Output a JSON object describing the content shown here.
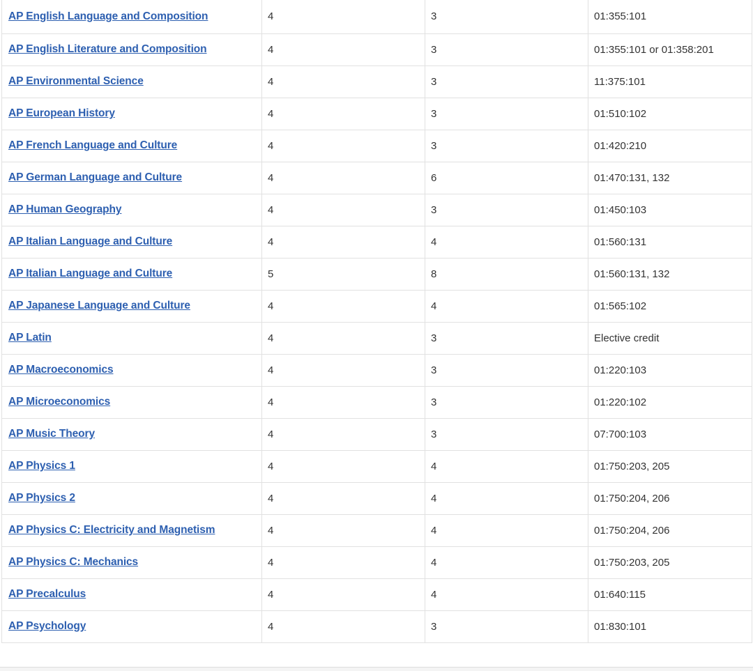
{
  "table": {
    "rows": [
      {
        "exam": "AP English Language and Composition",
        "score": "4",
        "credits": "3",
        "equivalent": "01:355:101"
      },
      {
        "exam": "AP English Literature and Composition",
        "score": "4",
        "credits": "3",
        "equivalent": "01:355:101 or 01:358:201"
      },
      {
        "exam": "AP Environmental Science",
        "score": "4",
        "credits": "3",
        "equivalent": "11:375:101"
      },
      {
        "exam": "AP European History",
        "score": "4",
        "credits": "3",
        "equivalent": "01:510:102"
      },
      {
        "exam": "AP French Language and Culture",
        "score": "4",
        "credits": "3",
        "equivalent": "01:420:210"
      },
      {
        "exam": "AP German Language and Culture",
        "score": "4",
        "credits": "6",
        "equivalent": "01:470:131, 132"
      },
      {
        "exam": "AP Human Geography",
        "score": "4",
        "credits": "3",
        "equivalent": "01:450:103"
      },
      {
        "exam": "AP Italian Language and Culture",
        "score": "4",
        "credits": "4",
        "equivalent": "01:560:131"
      },
      {
        "exam": "AP Italian Language and Culture",
        "score": "5",
        "credits": "8",
        "equivalent": "01:560:131, 132"
      },
      {
        "exam": "AP Japanese Language and Culture",
        "score": "4",
        "credits": "4",
        "equivalent": "01:565:102"
      },
      {
        "exam": "AP Latin",
        "score": "4",
        "credits": "3",
        "equivalent": "Elective credit"
      },
      {
        "exam": "AP Macroeconomics",
        "score": "4",
        "credits": "3",
        "equivalent": "01:220:103"
      },
      {
        "exam": "AP Microeconomics",
        "score": "4",
        "credits": "3",
        "equivalent": "01:220:102"
      },
      {
        "exam": "AP Music Theory",
        "score": "4",
        "credits": "3",
        "equivalent": "07:700:103"
      },
      {
        "exam": "AP Physics 1",
        "score": "4",
        "credits": "4",
        "equivalent": "01:750:203, 205"
      },
      {
        "exam": "AP Physics 2",
        "score": "4",
        "credits": "4",
        "equivalent": "01:750:204, 206"
      },
      {
        "exam": "AP Physics C: Electricity and Magnetism",
        "score": "4",
        "credits": "4",
        "equivalent": "01:750:204, 206"
      },
      {
        "exam": "AP Physics C: Mechanics",
        "score": "4",
        "credits": "4",
        "equivalent": "01:750:203, 205"
      },
      {
        "exam": "AP Precalculus",
        "score": "4",
        "credits": "4",
        "equivalent": "01:640:115"
      },
      {
        "exam": "AP Psychology",
        "score": "4",
        "credits": "3",
        "equivalent": "01:830:101"
      }
    ]
  },
  "colors": {
    "link": "#2d5fb0",
    "text": "#333333",
    "border": "#e1e1e1"
  }
}
